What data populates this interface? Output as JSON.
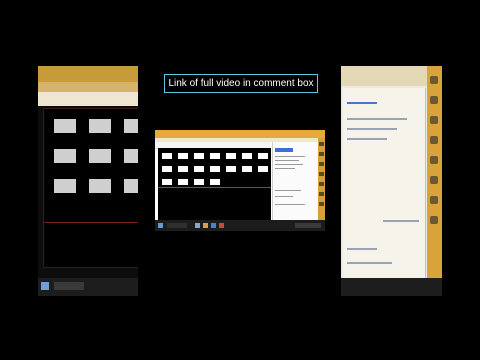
{
  "caption": {
    "text": "Link of full video in comment box"
  },
  "colors": {
    "caption_border": "#5ec7e6",
    "app_accent": "#e6a93a",
    "canvas_bg": "#000000",
    "shape_fill": "#ffffff",
    "divider_line": "#b13434",
    "taskbar": "#1c1c1c"
  },
  "icons": {
    "left_taskbar": [
      "start-icon",
      "search-icon",
      "taskview-icon"
    ],
    "right_taskbar": [
      "app-icon",
      "app-icon",
      "app-icon",
      "app-icon"
    ],
    "side_tools": [
      "tool-icon",
      "tool-icon",
      "tool-icon",
      "tool-icon",
      "tool-icon",
      "tool-icon",
      "tool-icon",
      "tool-icon"
    ]
  }
}
